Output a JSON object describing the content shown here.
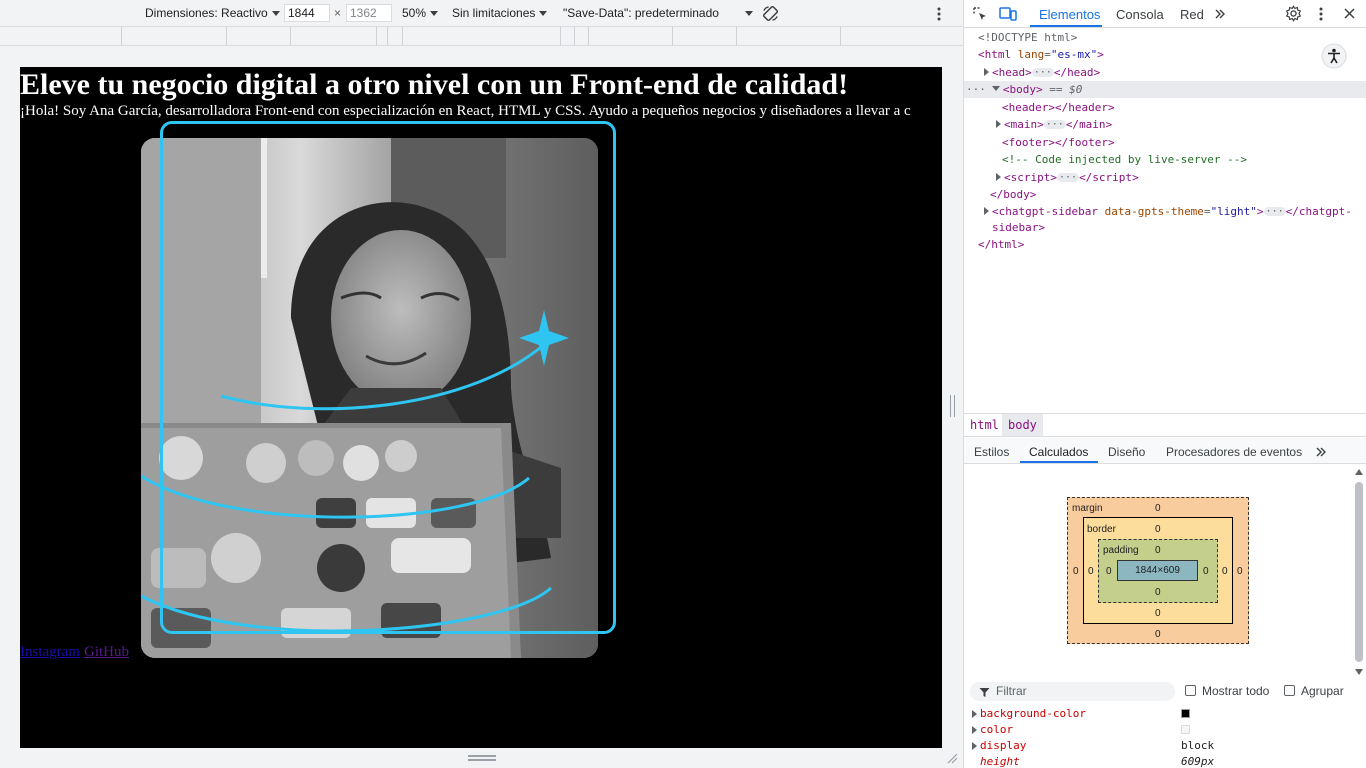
{
  "device_toolbar": {
    "dimensions_label": "Dimensiones: Reactivo",
    "width_value": "1844",
    "times": "×",
    "height_value": "1362",
    "zoom": "50%",
    "throttle": "Sin limitaciones",
    "save_data": "\"Save-Data\": predeterminado"
  },
  "page": {
    "heading": "Eleve tu negocio digital a otro nivel con un Front-end de calidad!",
    "intro": "¡Hola! Soy Ana García, desarrolladora Front-end con especialización en React, HTML y CSS. Ayudo a pequeños negocios y diseñadores a llevar a c",
    "links": [
      "Instagram",
      "GitHub"
    ],
    "accent_color": "#2ec5f2"
  },
  "devtools": {
    "tabs": [
      "Elementos",
      "Consola",
      "Red"
    ],
    "active_tab": "Elementos",
    "dom": {
      "doctype": "<!DOCTYPE html>",
      "html_open_tag": "html",
      "html_attr_name": "lang",
      "html_attr_value": "\"es-mx\"",
      "head": "head",
      "body": "body",
      "body_marker": "== $0",
      "header": "header",
      "main": "main",
      "footer": "footer",
      "comment": "<!-- Code injected by live-server -->",
      "script": "script",
      "sidebar_tag": "chatgpt-sidebar",
      "sidebar_attr_name": "data-gpts-theme",
      "sidebar_attr_value": "\"light\"",
      "sidebar_tail": "sidebar>",
      "html_close": "</html>",
      "body_close": "</body>"
    },
    "breadcrumbs": [
      "html",
      "body"
    ],
    "subtabs": [
      "Estilos",
      "Calculados",
      "Diseño",
      "Procesadores de eventos"
    ],
    "active_subtab": "Calculados",
    "box_model": {
      "margin_label": "margin",
      "border_label": "border",
      "padding_label": "padding",
      "content": "1844×609",
      "zero": "0"
    },
    "filter": {
      "placeholder": "Filtrar",
      "show_all": "Mostrar todo",
      "group": "Agrupar"
    },
    "computed": [
      {
        "name": "background-color",
        "value": ""
      },
      {
        "name": "color",
        "value": ""
      },
      {
        "name": "display",
        "value": "block"
      },
      {
        "name": "height",
        "value": "609px"
      }
    ]
  }
}
